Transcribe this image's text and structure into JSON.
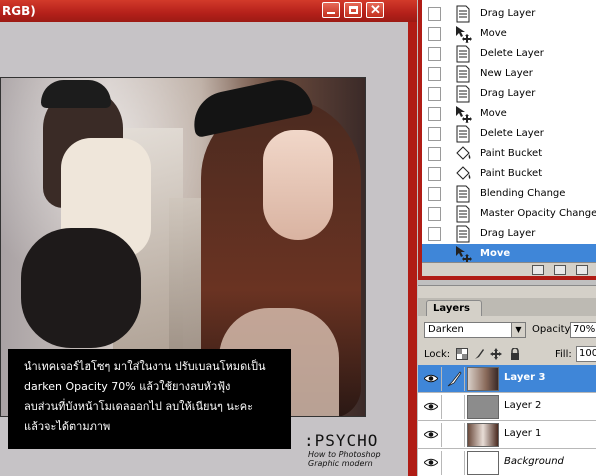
{
  "document": {
    "title": "RGB)",
    "caption_lines": [
      "นำเทคเจอร์ไฮโซๆ มาใส่ในงาน ปรับเบลนโหมดเป็น",
      "darken Opacity 70% แล้วใช้ยางลบหัวฟุ้ง",
      "ลบส่วนที่บังหน้าโมเดลออกไป ลบให้เนียนๆ นะคะ",
      "แล้วจะได้ตามภาพ"
    ],
    "watermark": {
      "title": ":PSYCHO",
      "subtitle": "How to Photoshop",
      "subtitle2": "Graphic modern"
    }
  },
  "history": {
    "items": [
      {
        "label": "Drag Layer",
        "icon": "layer-page-icon"
      },
      {
        "label": "Move",
        "icon": "move-tool-icon"
      },
      {
        "label": "Delete Layer",
        "icon": "layer-page-icon"
      },
      {
        "label": "New Layer",
        "icon": "layer-page-icon"
      },
      {
        "label": "Drag Layer",
        "icon": "layer-page-icon"
      },
      {
        "label": "Move",
        "icon": "move-tool-icon"
      },
      {
        "label": "Delete Layer",
        "icon": "layer-page-icon"
      },
      {
        "label": "Paint Bucket",
        "icon": "paint-bucket-icon"
      },
      {
        "label": "Paint Bucket",
        "icon": "paint-bucket-icon"
      },
      {
        "label": "Blending Change",
        "icon": "layer-page-icon"
      },
      {
        "label": "Master Opacity Change",
        "icon": "layer-page-icon"
      },
      {
        "label": "Drag Layer",
        "icon": "layer-page-icon"
      },
      {
        "label": "Move",
        "icon": "move-tool-icon",
        "selected": true
      }
    ]
  },
  "layers": {
    "tab_label": "Layers",
    "blend_mode": "Darken",
    "opacity_label": "Opacity:",
    "opacity_value": "70%",
    "lock_label": "Lock:",
    "fill_label": "Fill:",
    "fill_value": "100",
    "items": [
      {
        "name": "Layer 3",
        "selected": true
      },
      {
        "name": "Layer 2"
      },
      {
        "name": "Layer 1"
      },
      {
        "name": "Background"
      }
    ]
  },
  "colors": {
    "titlebar": "#b4201a",
    "selection": "#3f86d8",
    "panel_bg": "#d4d0c8"
  }
}
